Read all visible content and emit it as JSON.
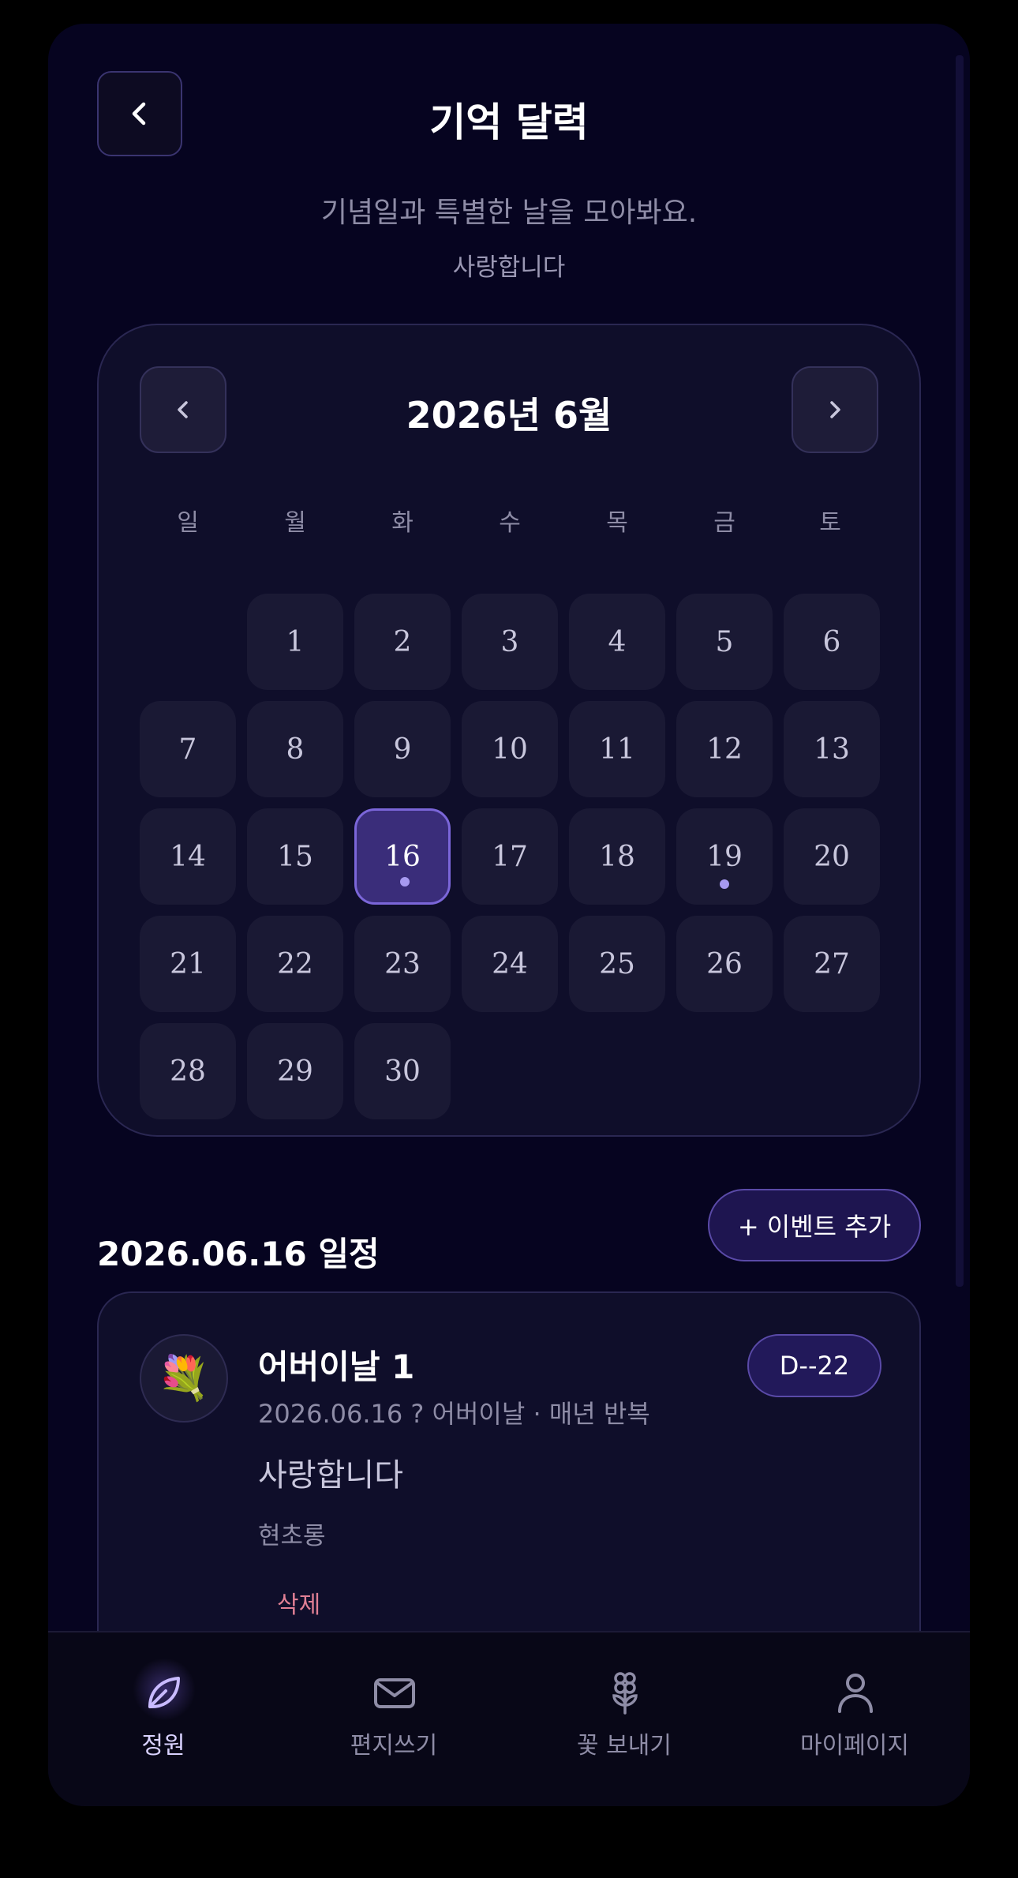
{
  "header": {
    "title": "기억 달력",
    "subtitle": "기념일과 특별한 날을 모아봐요.",
    "message": "사랑합니다"
  },
  "calendar": {
    "month_label": "2026년 6월",
    "weekdays": [
      "일",
      "월",
      "화",
      "수",
      "목",
      "금",
      "토"
    ],
    "days": [
      "1",
      "2",
      "3",
      "4",
      "5",
      "6",
      "7",
      "8",
      "9",
      "10",
      "11",
      "12",
      "13",
      "14",
      "15",
      "16",
      "17",
      "18",
      "19",
      "20",
      "21",
      "22",
      "23",
      "24",
      "25",
      "26",
      "27",
      "28",
      "29",
      "30"
    ],
    "first_weekday_index": 1,
    "selected_day": 16,
    "event_days": [
      16,
      19
    ]
  },
  "schedule": {
    "title": "2026.06.16 일정",
    "add_button_label": "+ 이벤트 추가"
  },
  "event": {
    "icon": "💐",
    "icon_name": "bouquet-icon",
    "title": "어버이날 1",
    "dday": "D--22",
    "meta": "2026.06.16 ? 어버이날 · 매년 반복",
    "message": "사랑합니다",
    "author": "현초롱",
    "delete_label": "삭제"
  },
  "nav": {
    "items": [
      {
        "label": "정원",
        "icon": "leaf-icon",
        "active": true
      },
      {
        "label": "편지쓰기",
        "icon": "mail-icon",
        "active": false
      },
      {
        "label": "꽃 보내기",
        "icon": "flower-icon",
        "active": false
      },
      {
        "label": "마이페이지",
        "icon": "user-icon",
        "active": false
      }
    ]
  },
  "colors": {
    "background": "#060420",
    "accent": "#7b66d9",
    "event_dot": "#a79af0",
    "delete": "#e07f94"
  }
}
